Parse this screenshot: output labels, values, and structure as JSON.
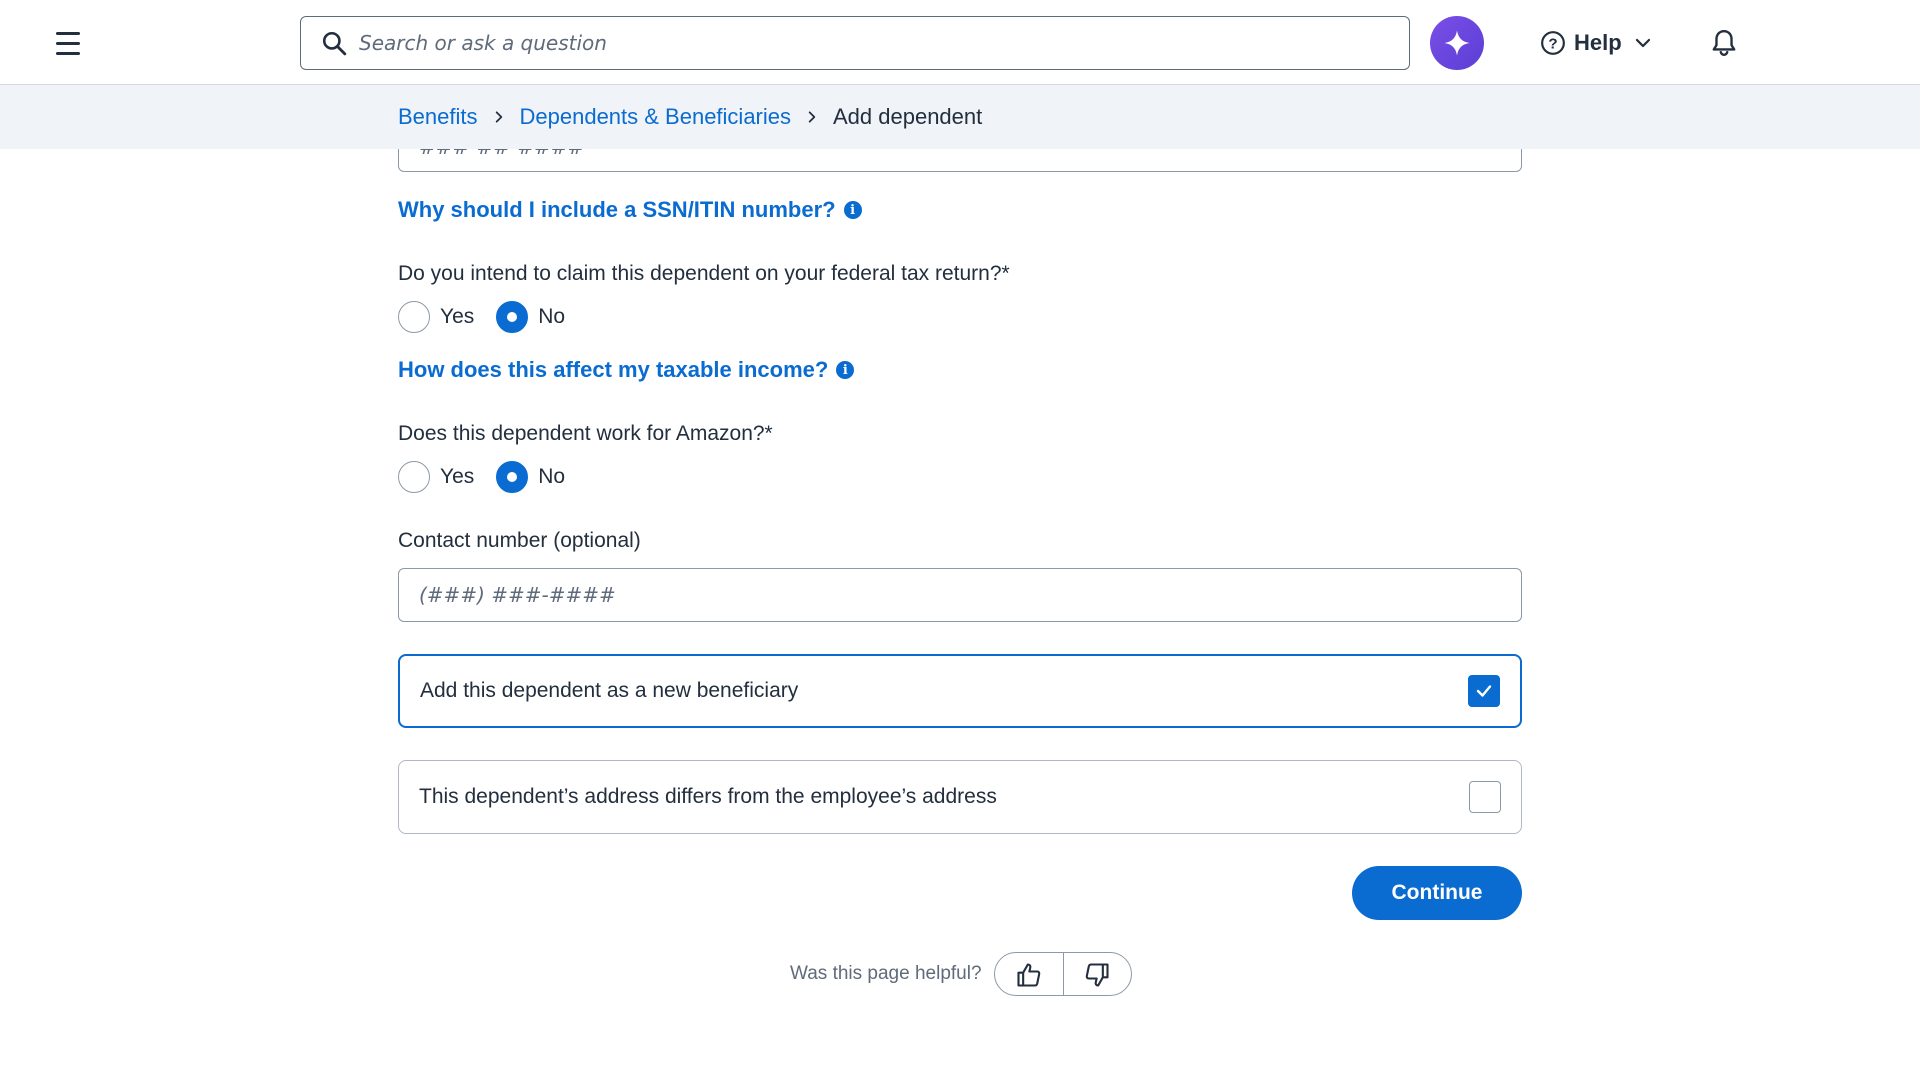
{
  "header": {
    "search_placeholder": "Search or ask a question",
    "help_label": "Help"
  },
  "breadcrumb": {
    "items": [
      "Benefits",
      "Dependents & Beneficiaries"
    ],
    "current": "Add dependent"
  },
  "form": {
    "ssn_placeholder": "###-##-####",
    "ssn_help_link": "Why should I include a SSN/ITIN number?",
    "tax_question": "Do you intend to claim this dependent on your federal tax return?*",
    "tax_options": [
      "Yes",
      "No"
    ],
    "tax_selected": "No",
    "taxable_help_link": "How does this affect my taxable income?",
    "amazon_question": "Does this dependent work for Amazon?*",
    "amazon_options": [
      "Yes",
      "No"
    ],
    "amazon_selected": "No",
    "contact_label": "Contact number (optional)",
    "contact_placeholder": "(###) ###-####",
    "beneficiary_label": "Add this dependent as a new beneficiary",
    "beneficiary_checked": true,
    "address_label": "This dependent’s address differs from the employee’s address",
    "address_checked": false,
    "continue_label": "Continue"
  },
  "feedback": {
    "question": "Was this page helpful?"
  },
  "colors": {
    "accent": "#0a6bd1",
    "ai_button": "#6a47de",
    "breadcrumb_bg": "#f0f3f7"
  }
}
